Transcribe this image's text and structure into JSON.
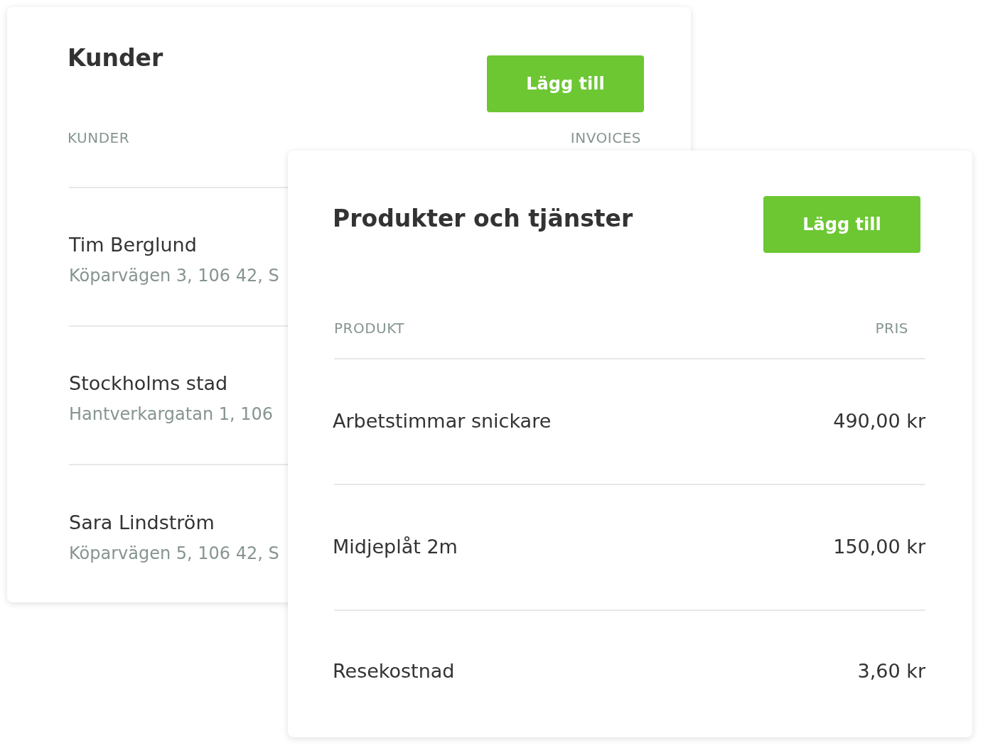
{
  "customers_card": {
    "title": "Kunder",
    "add_button": "Lägg till",
    "columns": [
      "KUNDER",
      "INVOICES"
    ],
    "rows": [
      {
        "name": "Tim Berglund",
        "address": "Köparvägen 3, 106 42, S"
      },
      {
        "name": "Stockholms stad",
        "address": "Hantverkargatan 1, 106"
      },
      {
        "name": "Sara Lindström",
        "address": "Köparvägen 5, 106 42, S"
      }
    ]
  },
  "products_card": {
    "title": "Produkter och tjänster",
    "add_button": "Lägg till",
    "columns": [
      "PRODUKT",
      "PRIS"
    ],
    "rows": [
      {
        "product": "Arbetstimmar snickare",
        "price": "490,00 kr"
      },
      {
        "product": "Midjeplåt 2m",
        "price": "150,00 kr"
      },
      {
        "product": "Resekostnad",
        "price": "3,60 kr"
      }
    ]
  }
}
